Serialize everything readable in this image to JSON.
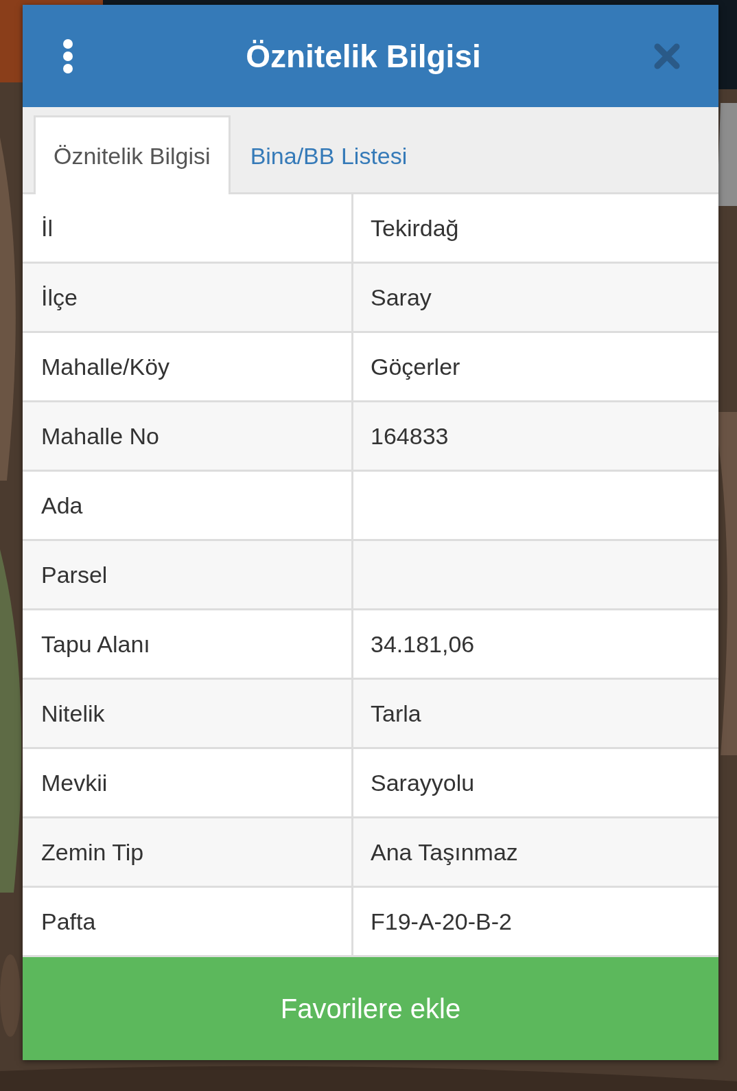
{
  "dialog": {
    "title": "Öznitelik Bilgisi"
  },
  "tabs": [
    {
      "label": "Öznitelik Bilgisi",
      "selected": true
    },
    {
      "label": "Bina/BB Listesi",
      "selected": false
    }
  ],
  "rows": [
    {
      "label": "İl",
      "value": "Tekirdağ"
    },
    {
      "label": "İlçe",
      "value": "Saray"
    },
    {
      "label": "Mahalle/Köy",
      "value": "Göçerler"
    },
    {
      "label": "Mahalle No",
      "value": "164833"
    },
    {
      "label": "Ada"
    },
    {
      "label": "Parsel"
    },
    {
      "label": "Tapu Alanı",
      "value": "34.181,06"
    },
    {
      "label": "Nitelik",
      "value": "Tarla"
    },
    {
      "label": "Mevkii",
      "value": "Sarayyolu"
    },
    {
      "label": "Zemin Tip",
      "value": "Ana Taşınmaz"
    },
    {
      "label": "Pafta",
      "value": "F19-A-20-B-2"
    }
  ],
  "button": "Favorilere ekle"
}
